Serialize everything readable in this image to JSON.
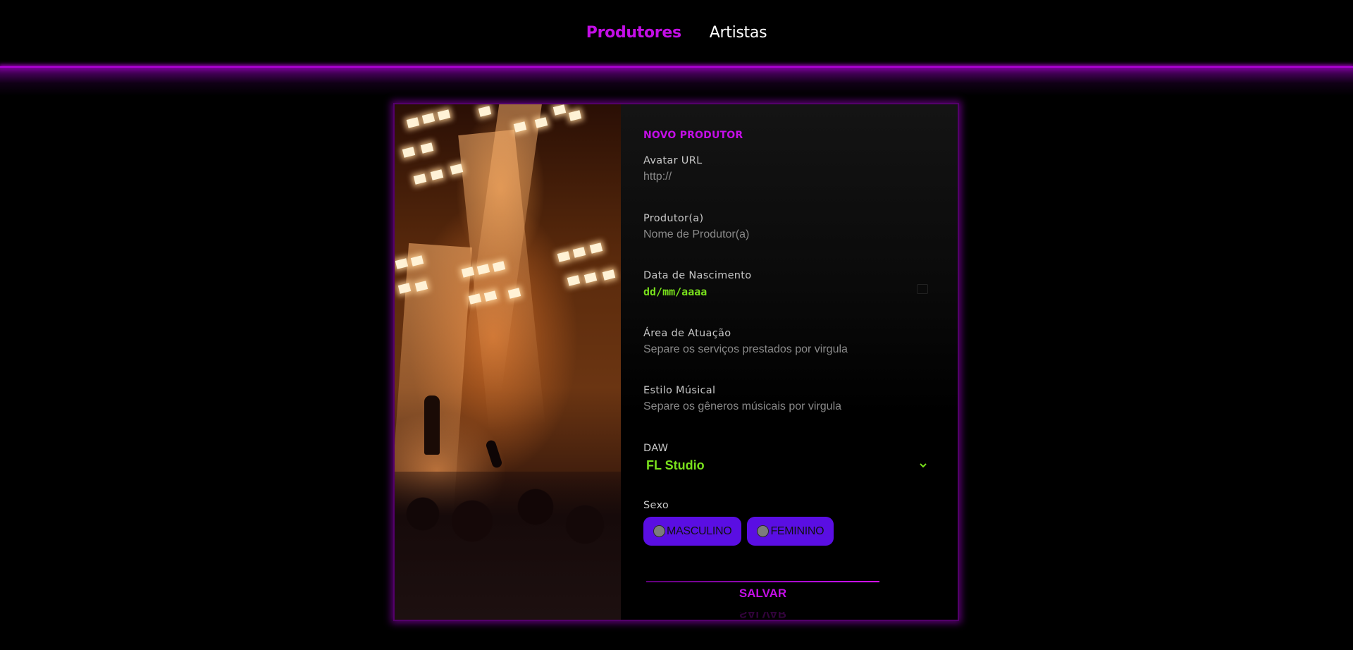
{
  "nav": {
    "links": [
      {
        "label": "Produtores",
        "active": true
      },
      {
        "label": "Artistas",
        "active": false
      }
    ]
  },
  "form": {
    "title": "NOVO PRODUTOR",
    "fields": {
      "avatar": {
        "label": "Avatar URL",
        "placeholder": "http://"
      },
      "producer": {
        "label": "Produtor(a)",
        "placeholder": "Nome de Produtor(a)"
      },
      "birth_date": {
        "label": "Data de Nascimento",
        "value": "dd/mm/aaaa"
      },
      "area": {
        "label": "Área de Atuação",
        "placeholder": "Separe os serviços prestados por virgula"
      },
      "style": {
        "label": "Estilo Músical",
        "placeholder": "Separe os gêneros músicais por virgula"
      },
      "daw": {
        "label": "DAW",
        "value": "FL Studio"
      },
      "sex": {
        "label": "Sexo",
        "options": [
          "MASCULINO",
          "FEMININO"
        ]
      }
    },
    "save_label": "SALVAR"
  },
  "colors": {
    "accent": "#c30ee6",
    "value_green": "#79e01c",
    "radio_bg": "#5a0ee3"
  }
}
